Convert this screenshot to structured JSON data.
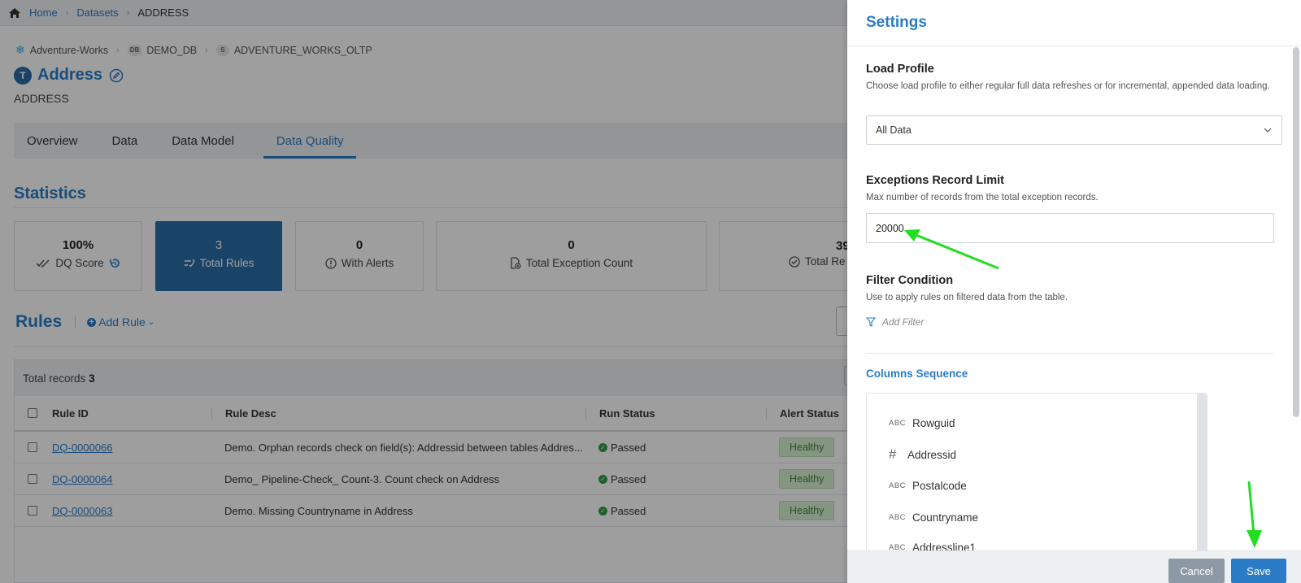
{
  "breadcrumb": {
    "home": "Home",
    "datasets": "Datasets",
    "current": "ADDRESS"
  },
  "path": {
    "source": "Adventure-Works",
    "db_chip": "DB",
    "db": "DEMO_DB",
    "schema_chip": "S",
    "schema": "ADVENTURE_WORKS_OLTP"
  },
  "asset": {
    "type_badge": "T",
    "title": "Address",
    "subtitle": "ADDRESS"
  },
  "tabs": [
    "Overview",
    "Data",
    "Data Model",
    "Data Quality"
  ],
  "statistics": {
    "heading": "Statistics",
    "cards": [
      {
        "value": "100%",
        "label": "DQ Score"
      },
      {
        "value": "3",
        "label": "Total Rules"
      },
      {
        "value": "0",
        "label": "With Alerts"
      },
      {
        "value": "0",
        "label": "Total Exception Count"
      },
      {
        "value": "39",
        "label": "Total Re"
      }
    ]
  },
  "rules": {
    "heading": "Rules",
    "add_rule": "Add Rule",
    "total_records_label": "Total records",
    "total_records_value": "3",
    "columns": [
      "Rule ID",
      "Rule Desc",
      "Run Status",
      "Alert Status"
    ],
    "rows": [
      {
        "id": "DQ-0000066",
        "desc": "Demo. Orphan records check on field(s): Addressid between tables Addres...",
        "run": "Passed",
        "alert": "Healthy"
      },
      {
        "id": "DQ-0000064",
        "desc": "Demo_ Pipeline-Check_ Count-3. Count check on Address",
        "run": "Passed",
        "alert": "Healthy"
      },
      {
        "id": "DQ-0000063",
        "desc": "Demo. Missing Countryname in Address",
        "run": "Passed",
        "alert": "Healthy"
      }
    ]
  },
  "settings": {
    "title": "Settings",
    "load_profile": {
      "title": "Load Profile",
      "desc": "Choose load profile to either regular full data refreshes or for incremental, appended data loading.",
      "value": "All Data"
    },
    "exceptions": {
      "title": "Exceptions Record Limit",
      "desc": "Max number of records from the total exception records.",
      "value": "20000"
    },
    "filter": {
      "title": "Filter Condition",
      "desc": "Use to apply rules on filtered data from the table.",
      "add_filter": "Add Filter"
    },
    "columns_sequence": {
      "title": "Columns Sequence",
      "items": [
        {
          "type": "ABC",
          "name": "Rowguid"
        },
        {
          "type": "#",
          "name": "Addressid"
        },
        {
          "type": "ABC",
          "name": "Postalcode"
        },
        {
          "type": "ABC",
          "name": "Countryname"
        },
        {
          "type": "ABC",
          "name": "Addressline1"
        }
      ]
    },
    "cancel": "Cancel",
    "save": "Save"
  },
  "colors": {
    "accent": "#2b7cc7",
    "active_card": "#2b6da8",
    "healthy_bg": "#d8f0d3",
    "passed": "#2e9e44",
    "annotation_arrow": "#22dd22"
  }
}
